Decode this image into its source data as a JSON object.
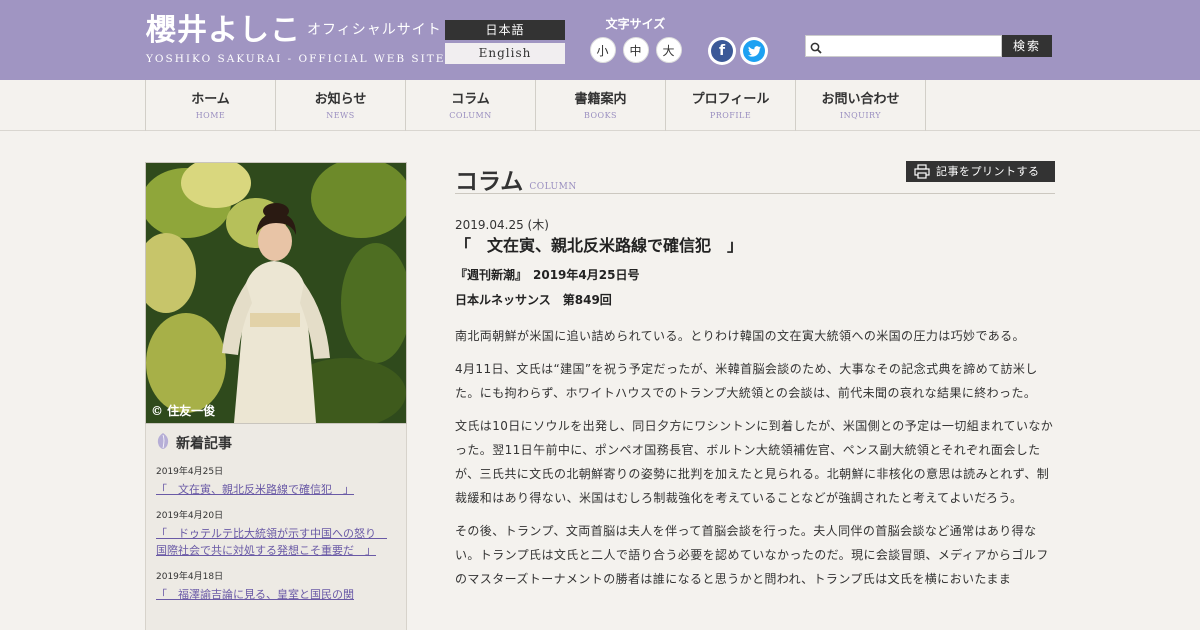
{
  "header": {
    "logo_main": "櫻井よしこ",
    "logo_sub": "オフィシャルサイト",
    "logo_en": "YOSHIKO SAKURAI - OFFICIAL WEB SITE",
    "lang_ja": "日本語",
    "lang_en": "English",
    "font_size_label": "文字サイズ",
    "font_sizes": [
      "小",
      "中",
      "大"
    ],
    "social": {
      "facebook": "f",
      "twitter": "t"
    },
    "search": {
      "value": "",
      "placeholder": "",
      "button": "検索"
    }
  },
  "nav": [
    {
      "ja": "ホーム",
      "en": "HOME"
    },
    {
      "ja": "お知らせ",
      "en": "NEWS"
    },
    {
      "ja": "コラム",
      "en": "COLUMN"
    },
    {
      "ja": "書籍案内",
      "en": "BOOKS"
    },
    {
      "ja": "プロフィール",
      "en": "PROFILE"
    },
    {
      "ja": "お問い合わせ",
      "en": "INQUIRY"
    }
  ],
  "sidebar": {
    "photo_credit": "© 住友一俊",
    "news_heading": "新着記事",
    "news": [
      {
        "date": "2019年4月25日",
        "title": "「　文在寅、親北反米路線で確信犯　」"
      },
      {
        "date": "2019年4月20日",
        "title": "「　ドゥテルテ比大統領が示す中国への怒り　国際社会で共に対処する発想こそ重要だ　」"
      },
      {
        "date": "2019年4月18日",
        "title": "「　福澤諭吉論に見る、皇室と国民の関"
      }
    ]
  },
  "main": {
    "section_title": "コラム",
    "section_title_en": "COLUMN",
    "print_button": "記事をプリントする",
    "post_date": "2019.04.25 (木)",
    "post_title": "「　文在寅、親北反米路線で確信犯　」",
    "post_meta": "『週刊新潮』　2019年4月25日号",
    "post_meta2": "日本ルネッサンス　第849回",
    "paragraphs": [
      "南北両朝鮮が米国に追い詰められている。とりわけ韓国の文在寅大統領への米国の圧力は巧妙である。",
      "4月11日、文氏は“建国”を祝う予定だったが、米韓首脳会談のため、大事なその記念式典を諦めて訪米した。にも拘わらず、ホワイトハウスでのトランプ大統領との会談は、前代未聞の哀れな結果に終わった。",
      "文氏は10日にソウルを出発し、同日夕方にワシントンに到着したが、米国側との予定は一切組まれていなかった。翌11日午前中に、ポンペオ国務長官、ボルトン大統領補佐官、ペンス副大統領とそれぞれ面会したが、三氏共に文氏の北朝鮮寄りの姿勢に批判を加えたと見られる。北朝鮮に非核化の意思は読みとれず、制裁緩和はあり得ない、米国はむしろ制裁強化を考えていることなどが強調されたと考えてよいだろう。",
      "その後、トランプ、文両首脳は夫人を伴って首脳会談を行った。夫人同伴の首脳会談など通常はあり得ない。トランプ氏は文氏と二人で語り合う必要を認めていなかったのだ。現に会談冒頭、メディアからゴルフのマスターズトーナメントの勝者は誰になると思うかと問われ、トランプ氏は文氏を横においたまま"
    ]
  },
  "colors": {
    "header_bg": "#a095c2",
    "link": "#6a5aa6",
    "accent_en": "#9a8fc0",
    "dark_button": "#333333"
  }
}
